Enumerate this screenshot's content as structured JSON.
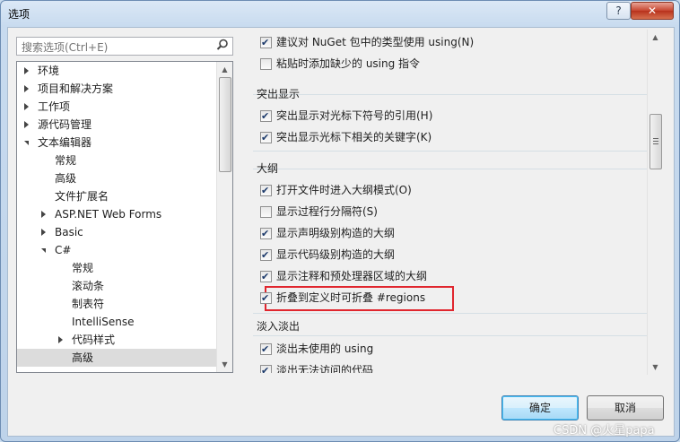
{
  "window": {
    "title": "选项",
    "help_label": "?",
    "close_label": "✕"
  },
  "search": {
    "placeholder": "搜索选项(Ctrl+E)"
  },
  "tree": [
    {
      "label": "环境",
      "level": 0,
      "expander": "closed"
    },
    {
      "label": "项目和解决方案",
      "level": 0,
      "expander": "closed"
    },
    {
      "label": "工作项",
      "level": 0,
      "expander": "closed"
    },
    {
      "label": "源代码管理",
      "level": 0,
      "expander": "closed"
    },
    {
      "label": "文本编辑器",
      "level": 0,
      "expander": "open"
    },
    {
      "label": "常规",
      "level": 1,
      "expander": "none"
    },
    {
      "label": "高级",
      "level": 1,
      "expander": "none"
    },
    {
      "label": "文件扩展名",
      "level": 1,
      "expander": "none"
    },
    {
      "label": "ASP.NET Web Forms",
      "level": 1,
      "expander": "closed"
    },
    {
      "label": "Basic",
      "level": 1,
      "expander": "closed"
    },
    {
      "label": "C#",
      "level": 1,
      "expander": "open"
    },
    {
      "label": "常规",
      "level": 2,
      "expander": "none"
    },
    {
      "label": "滚动条",
      "level": 2,
      "expander": "none"
    },
    {
      "label": "制表符",
      "level": 2,
      "expander": "none"
    },
    {
      "label": "IntelliSense",
      "level": 2,
      "expander": "none"
    },
    {
      "label": "代码样式",
      "level": 2,
      "expander": "closed"
    },
    {
      "label": "高级",
      "level": 2,
      "expander": "none",
      "selected": true
    }
  ],
  "options": {
    "top": [
      {
        "label": "建议对 NuGet 包中的类型使用 using(N)",
        "checked": true
      },
      {
        "label": "粘贴时添加缺少的 using 指令",
        "checked": false
      }
    ],
    "highlight_group": {
      "title": "突出显示",
      "items": [
        {
          "label": "突出显示对光标下符号的引用(H)",
          "checked": true
        },
        {
          "label": "突出显示光标下相关的关键字(K)",
          "checked": true
        }
      ]
    },
    "outline_group": {
      "title": "大纲",
      "items": [
        {
          "label": "打开文件时进入大纲模式(O)",
          "checked": true
        },
        {
          "label": "显示过程行分隔符(S)",
          "checked": false
        },
        {
          "label": "显示声明级别构造的大纲",
          "checked": true
        },
        {
          "label": "显示代码级别构造的大纲",
          "checked": true
        },
        {
          "label": "显示注释和预处理器区域的大纲",
          "checked": true
        },
        {
          "label": "折叠到定义时可折叠 #regions",
          "checked": true
        }
      ]
    },
    "fade_group": {
      "title": "淡入淡出",
      "items": [
        {
          "label": "淡出未使用的 using",
          "checked": true
        },
        {
          "label": "淡出无法访问的代码",
          "checked": true
        }
      ]
    }
  },
  "buttons": {
    "ok": "确定",
    "cancel": "取消"
  },
  "watermark": "CSDN @火星papa"
}
